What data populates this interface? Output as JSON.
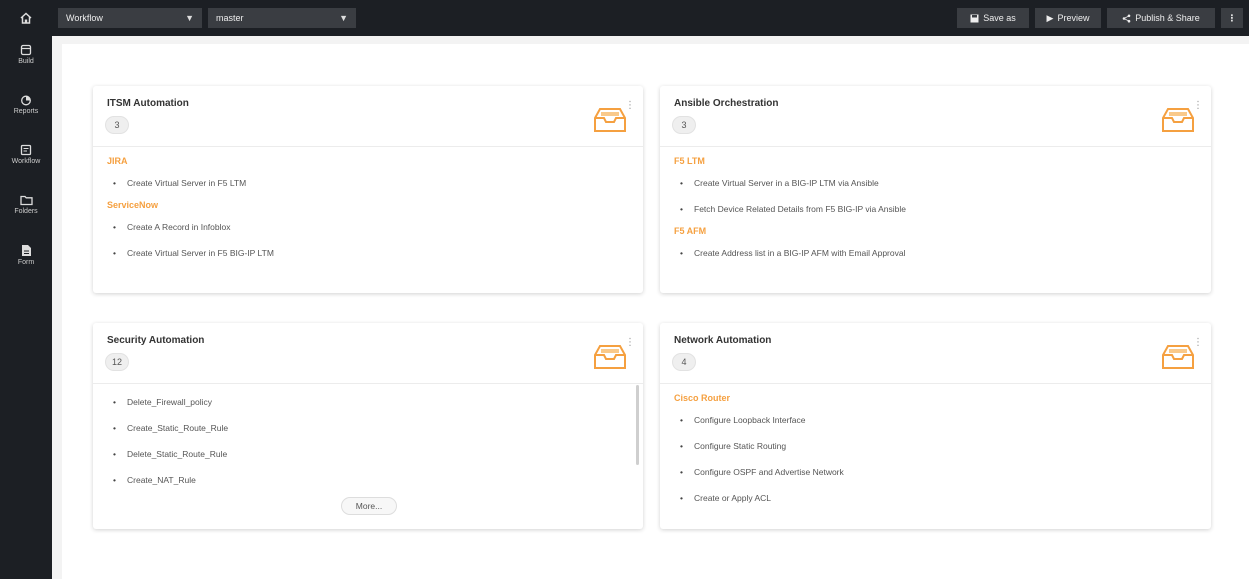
{
  "topbar": {
    "home_icon": "home-icon",
    "workflow_select": "Workflow",
    "branch_select": "master",
    "save_as": "Save as",
    "preview": "Preview",
    "publish_share": "Publish & Share",
    "more": "⋮"
  },
  "sidebar": {
    "items": [
      {
        "label": "Build",
        "icon": "build-icon"
      },
      {
        "label": "Reports",
        "icon": "reports-icon"
      },
      {
        "label": "Workflow",
        "icon": "workflow-icon"
      },
      {
        "label": "Folders",
        "icon": "folder-icon"
      },
      {
        "label": "Form",
        "icon": "form-icon"
      }
    ]
  },
  "cards": {
    "itsm": {
      "title": "ITSM Automation",
      "count": "3",
      "groups": [
        {
          "label": "JIRA",
          "items": [
            "Create Virtual Server in F5 LTM"
          ]
        },
        {
          "label": "ServiceNow",
          "items": [
            "Create A Record in Infoblox",
            "Create Virtual Server in F5 BIG-IP LTM"
          ]
        }
      ]
    },
    "ansible": {
      "title": "Ansible Orchestration",
      "count": "3",
      "groups": [
        {
          "label": "F5 LTM",
          "items": [
            "Create Virtual Server in a BIG-IP LTM via Ansible",
            "Fetch Device Related Details from F5 BIG-IP via Ansible"
          ]
        },
        {
          "label": "F5 AFM",
          "items": [
            "Create Address list in a BIG-IP AFM with Email Approval"
          ]
        }
      ]
    },
    "security": {
      "title": "Security Automation",
      "count": "12",
      "items": [
        "Delete_Firewall_policy",
        "Create_Static_Route_Rule",
        "Delete_Static_Route_Rule",
        "Create_NAT_Rule"
      ],
      "more": "More..."
    },
    "network": {
      "title": "Network Automation",
      "count": "4",
      "groups": [
        {
          "label": "Cisco Router",
          "items": [
            "Configure Loopback Interface",
            "Configure Static Routing",
            "Configure OSPF and Advertise Network",
            "Create or Apply ACL"
          ]
        }
      ]
    }
  },
  "colors": {
    "accent": "#f5a040",
    "topbar": "#1c1f24"
  }
}
